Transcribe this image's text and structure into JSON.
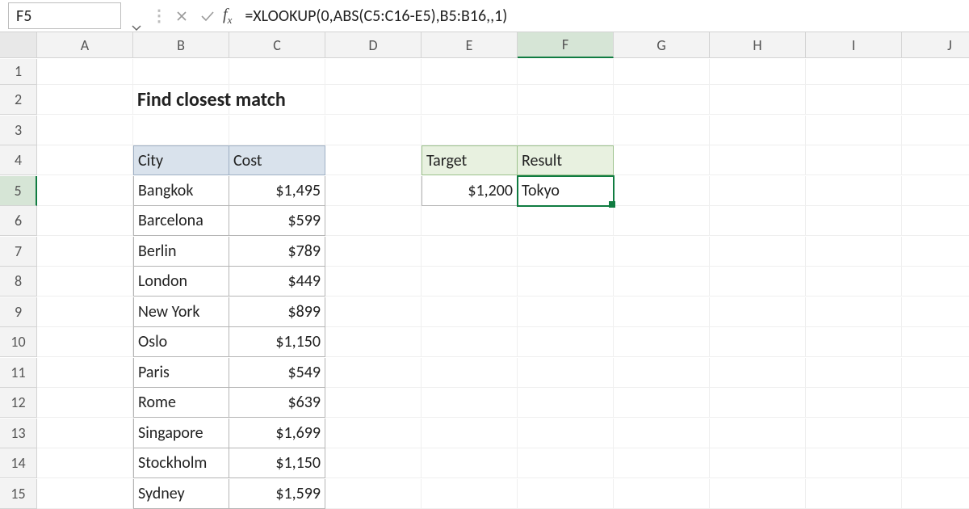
{
  "namebox": {
    "value": "F5"
  },
  "formula": "=XLOOKUP(0,ABS(C5:C16-E5),B5:B16,,1)",
  "columns": [
    "A",
    "B",
    "C",
    "D",
    "E",
    "F",
    "G",
    "H",
    "I",
    "J"
  ],
  "rows": [
    "1",
    "2",
    "3",
    "4",
    "5",
    "6",
    "7",
    "8",
    "9",
    "10",
    "11",
    "12",
    "13",
    "14",
    "15"
  ],
  "selected_row": "5",
  "selected_col": "F",
  "title": "Find closest match",
  "table": {
    "headers": {
      "b": "City",
      "c": "Cost"
    },
    "rows": [
      {
        "b": "Bangkok",
        "c": "$1,495"
      },
      {
        "b": "Barcelona",
        "c": "$599"
      },
      {
        "b": "Berlin",
        "c": "$789"
      },
      {
        "b": "London",
        "c": "$449"
      },
      {
        "b": "New York",
        "c": "$899"
      },
      {
        "b": "Oslo",
        "c": "$1,150"
      },
      {
        "b": "Paris",
        "c": "$549"
      },
      {
        "b": "Rome",
        "c": "$639"
      },
      {
        "b": "Singapore",
        "c": "$1,699"
      },
      {
        "b": "Stockholm",
        "c": "$1,150"
      },
      {
        "b": "Sydney",
        "c": "$1,599"
      }
    ]
  },
  "result": {
    "headers": {
      "e": "Target",
      "f": "Result"
    },
    "values": {
      "e": "$1,200",
      "f": "Tokyo"
    }
  }
}
